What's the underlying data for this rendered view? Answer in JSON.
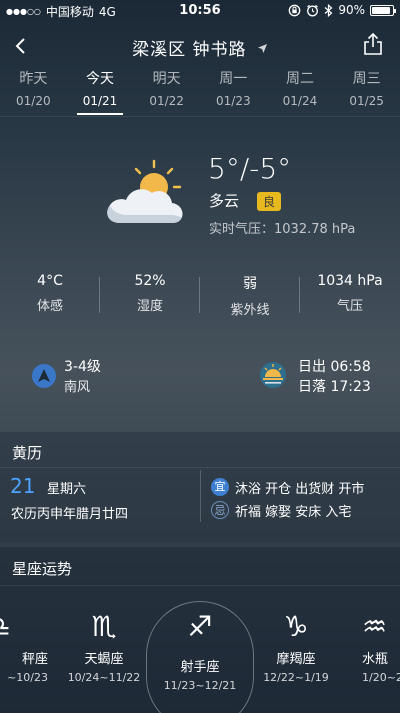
{
  "status_bar": {
    "signal": "●●●○○",
    "carrier": "中国移动",
    "network": "4G",
    "time": "10:56",
    "battery": "90%",
    "battery_level": 0.9
  },
  "header": {
    "city": "梁溪区 钟书路"
  },
  "tabs": [
    {
      "name": "昨天",
      "date": "01/20"
    },
    {
      "name": "今天",
      "date": "01/21"
    },
    {
      "name": "明天",
      "date": "01/22"
    },
    {
      "name": "周一",
      "date": "01/23"
    },
    {
      "name": "周二",
      "date": "01/24"
    },
    {
      "name": "周三",
      "date": "01/25"
    }
  ],
  "current": {
    "temp_range": "5°/-5°",
    "condition": "多云",
    "aqi": "良",
    "pressure_label": "实时气压：",
    "pressure_value": "1032.78 hPa",
    "icon": "partly-cloudy-icon"
  },
  "metrics": [
    {
      "value": "4°C",
      "label": "体感"
    },
    {
      "value": "52%",
      "label": "湿度"
    },
    {
      "value": "弱",
      "label": "紫外线"
    },
    {
      "value": "1034 hPa",
      "label": "气压"
    }
  ],
  "wind": {
    "level": "3-4级",
    "direction": "南风"
  },
  "sun": {
    "sunrise": "日出 06:58",
    "sunset": "日落 17:23"
  },
  "almanac": {
    "title": "黄历",
    "day": "21",
    "weekday": "星期六",
    "lunar": "农历丙申年腊月廿四",
    "yi_label": "宜",
    "yi": "沐浴 开仓 出货财 开市",
    "ji_label": "忌",
    "ji": "祈福 嫁娶 安床 入宅"
  },
  "horoscope": {
    "title": "星座运势",
    "signs": [
      {
        "glyph": "♎",
        "name": "秤座",
        "dates": "~10/23"
      },
      {
        "glyph": "♏",
        "name": "天蝎座",
        "dates": "10/24~11/22"
      },
      {
        "glyph": "♐",
        "name": "射手座",
        "dates": "11/23~12/21"
      },
      {
        "glyph": "♑",
        "name": "摩羯座",
        "dates": "12/22~1/19"
      },
      {
        "glyph": "♒",
        "name": "水瓶",
        "dates": "1/20~2"
      }
    ]
  },
  "colors": {
    "accent_blue": "#4da3ff",
    "aqi_badge": "#e8b91e",
    "yi_badge": "#3f7fd0"
  }
}
